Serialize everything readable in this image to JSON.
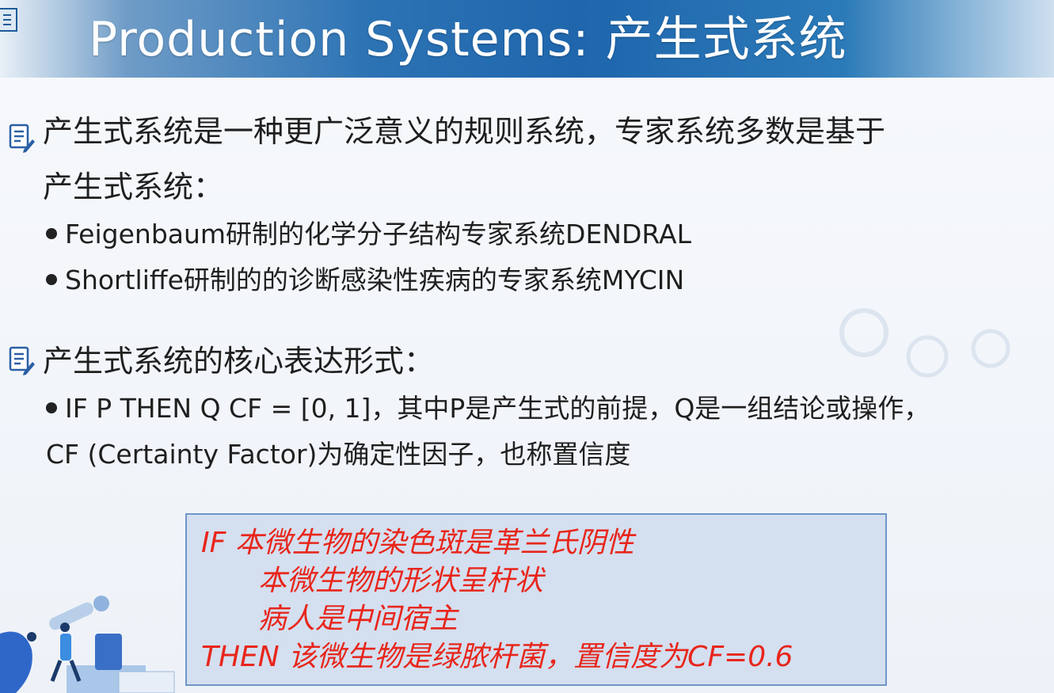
{
  "slide": {
    "title": "Production Systems: 产生式系统",
    "section1": {
      "line1": "产生式系统是一种更广泛意义的规则系统，专家系统多数是基于",
      "line2": "产生式系统：",
      "bullets": [
        "Feigenbaum研制的化学分子结构专家系统DENDRAL",
        "Shortliffe研制的的诊断感染性疾病的专家系统MYCIN"
      ]
    },
    "section2": {
      "heading": "产生式系统的核心表达形式：",
      "bullet_line1": "IF P THEN Q   CF = [0, 1]，其中P是产生式的前提，Q是一组结论或操作，",
      "bullet_line2": "CF (Certainty Factor)为确定性因子，也称置信度"
    },
    "rule_box": {
      "lines": [
        "IF   本微生物的染色斑是革兰氏阴性",
        "本微生物的形状呈杆状",
        "病人是中间宿主",
        "THEN  该微生物是绿脓杆菌，置信度为CF=0.6"
      ]
    }
  },
  "colors": {
    "banner_blue": "#1f66ad",
    "rule_text": "#e8261b",
    "rule_box_bg": "#d4dff0",
    "rule_box_border": "#6e96c8"
  },
  "icons": [
    "notepad-pencil-icon",
    "document-icon"
  ]
}
